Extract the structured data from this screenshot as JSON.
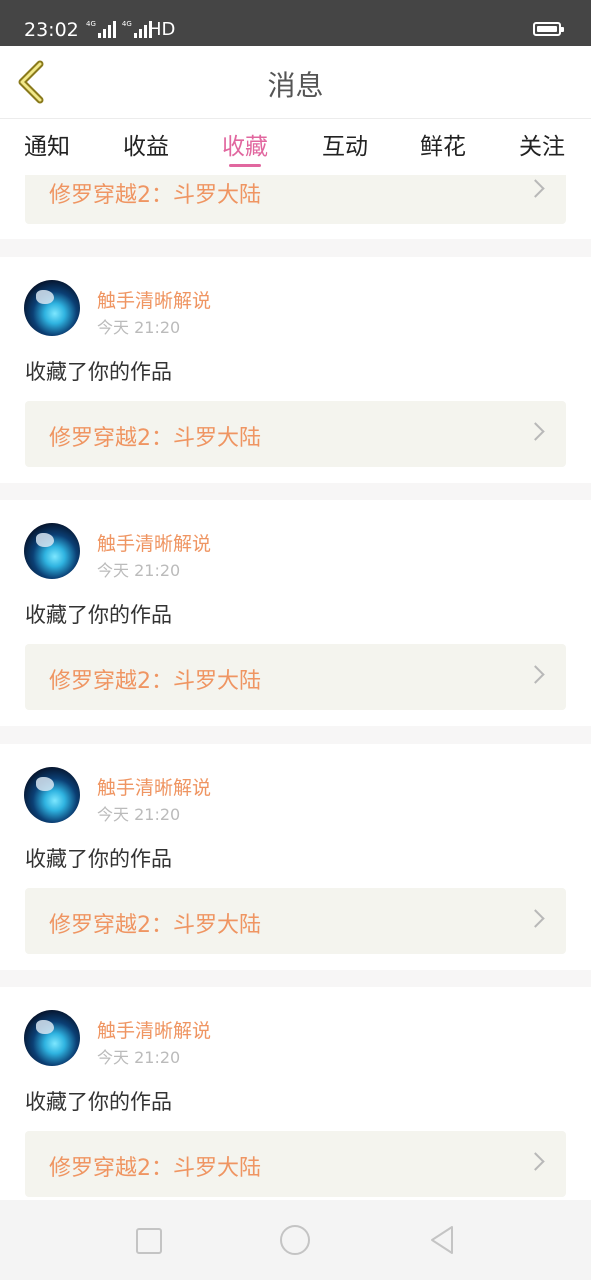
{
  "status_bar": {
    "time": "23:02",
    "network_label": "HD",
    "signal_1_label": "4G",
    "signal_2_label": "4G",
    "battery_icon": "battery-icon"
  },
  "header": {
    "title": "消息",
    "back_icon": "chevron-left-icon",
    "accent_color": "#e1679f"
  },
  "tabs": [
    {
      "label": "通知",
      "active": false
    },
    {
      "label": "收益",
      "active": false
    },
    {
      "label": "收藏",
      "active": true
    },
    {
      "label": "互动",
      "active": false
    },
    {
      "label": "鲜花",
      "active": false
    },
    {
      "label": "关注",
      "active": false
    }
  ],
  "partial_item": {
    "work_title": "修罗穿越2：斗罗大陆"
  },
  "messages": [
    {
      "username": "触手清晰解说",
      "time": "今天 21:20",
      "action": "收藏了你的作品",
      "work_title": "修罗穿越2：斗罗大陆"
    },
    {
      "username": "触手清晰解说",
      "time": "今天 21:20",
      "action": "收藏了你的作品",
      "work_title": "修罗穿越2：斗罗大陆"
    },
    {
      "username": "触手清晰解说",
      "time": "今天 21:20",
      "action": "收藏了你的作品",
      "work_title": "修罗穿越2：斗罗大陆"
    },
    {
      "username": "触手清晰解说",
      "time": "今天 21:20",
      "action": "收藏了你的作品",
      "work_title": "修罗穿越2：斗罗大陆"
    }
  ],
  "colors": {
    "username": "#ef9562",
    "work_title": "#ef9562",
    "work_box_bg": "#f4f4ee"
  },
  "bottom_nav": {
    "recents_icon": "square-icon",
    "home_icon": "circle-icon",
    "back_icon": "triangle-back-icon"
  }
}
